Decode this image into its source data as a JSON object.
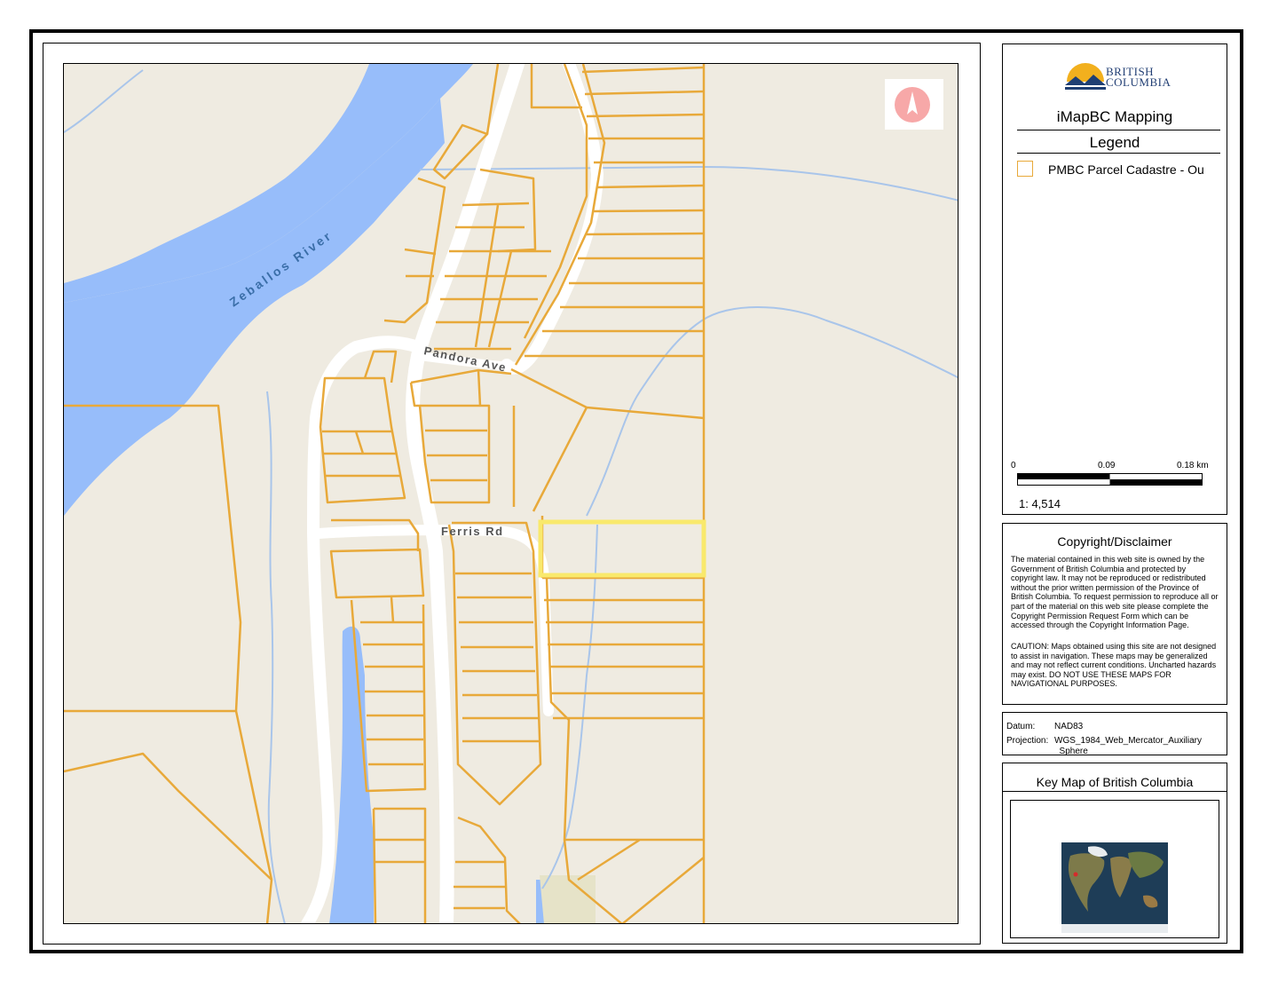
{
  "map": {
    "labels": {
      "river": "Zeballos River",
      "road_1": "Pandora Ave",
      "road_2": "Ferris Rd"
    },
    "colors": {
      "land": "#efebe1",
      "water": "#97bdfa",
      "stream": "#a9c5ea",
      "parcel": "#e8a93a",
      "road": "#ffffff",
      "highlight": "#f9e96c",
      "park": "#e6e3c8"
    }
  },
  "north_arrow": {
    "icon": "north-arrow-icon"
  },
  "legend_panel": {
    "logo_line1": "BRITISH",
    "logo_line2": "COLUMBIA",
    "map_title": "iMapBC Mapping",
    "legend_title": "Legend",
    "legend_items": [
      {
        "label": "PMBC Parcel Cadastre - Ou",
        "color": "#e8a93a"
      }
    ],
    "scale_ticks": [
      "0",
      "0.09",
      "0.18 km"
    ],
    "scale_text": "1: 4,514"
  },
  "copyright": {
    "title": "Copyright/Disclaimer",
    "body": "The material contained in this web site is owned by the Government of British Columbia and protected by copyright law. It may not be reproduced or redistributed without the prior written permission of the Province of British Columbia. To request permission to reproduce all or part of the material on this web site please complete the Copyright Permission Request Form which can be accessed through the Copyright Information Page.",
    "caution": "CAUTION: Maps obtained using this site are not designed to assist in navigation. These maps may be generalized and may not reflect current conditions. Uncharted hazards may exist. DO NOT USE THESE MAPS FOR NAVIGATIONAL PURPOSES."
  },
  "datum": {
    "datum_label": "Datum:",
    "datum_value": "NAD83",
    "projection_label": "Projection:",
    "projection_value": "WGS_1984_Web_Mercator_Auxiliary _Sphere"
  },
  "keymap": {
    "title": "Key Map of British Columbia"
  }
}
